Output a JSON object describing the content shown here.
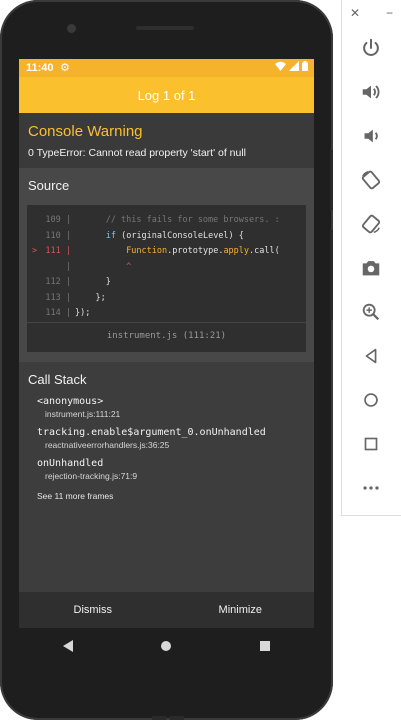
{
  "status_bar": {
    "time": "11:40"
  },
  "header": {
    "title": "Log 1 of 1"
  },
  "warning": {
    "title": "Console Warning",
    "message": "0 TypeError: Cannot read property 'start' of null"
  },
  "source": {
    "title": "Source",
    "lines": [
      {
        "num": "109",
        "text": "      // this fails for some browsers. :",
        "kind": "comment",
        "marker": ""
      },
      {
        "num": "110",
        "text": "      if (originalConsoleLevel) {",
        "kind": "kw",
        "marker": ""
      },
      {
        "num": "111",
        "text": "          Function.prototype.apply.call(",
        "kind": "fn",
        "marker": ">"
      },
      {
        "num": "",
        "text": "          ^",
        "kind": "err",
        "marker": ""
      },
      {
        "num": "112",
        "text": "      }",
        "kind": "plain",
        "marker": ""
      },
      {
        "num": "113",
        "text": "    };",
        "kind": "plain",
        "marker": ""
      },
      {
        "num": "114",
        "text": "});",
        "kind": "plain",
        "marker": ""
      }
    ],
    "file": "instrument.js (111:21)"
  },
  "call_stack": {
    "title": "Call Stack",
    "frames": [
      {
        "fn": "<anonymous>",
        "file": "instrument.js:111:21"
      },
      {
        "fn": "tracking.enable$argument_0.onUnhandled",
        "file": "reactnativeerrorhandlers.js:36:25"
      },
      {
        "fn": "onUnhandled",
        "file": "rejection-tracking.js:71:9"
      }
    ],
    "more": "See 11 more frames"
  },
  "actions": {
    "dismiss": "Dismiss",
    "minimize": "Minimize"
  },
  "colors": {
    "accent": "#fbc02d",
    "background": "#3d3d3d",
    "error": "#e05252"
  },
  "emulator_toolbar": {
    "window_controls": [
      "close-icon",
      "minimize-icon"
    ],
    "tools": [
      "power-icon",
      "volume-up-icon",
      "volume-down-icon",
      "rotate-left-icon",
      "rotate-right-icon",
      "camera-icon",
      "zoom-icon",
      "back-icon",
      "home-icon",
      "overview-icon",
      "more-icon"
    ]
  }
}
